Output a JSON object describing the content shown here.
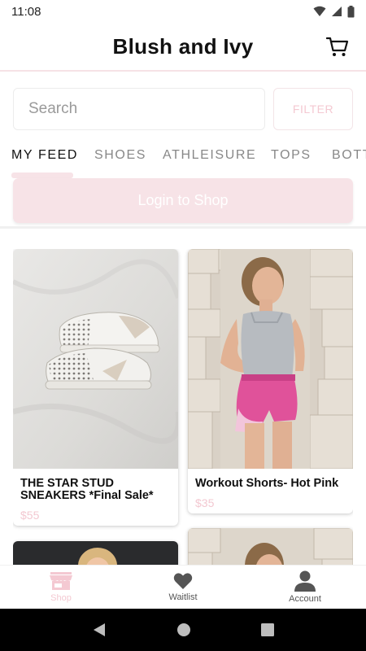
{
  "status_bar": {
    "time": "11:08"
  },
  "header": {
    "title": "Blush and Ivy"
  },
  "search": {
    "placeholder": "Search",
    "filter_label": "FILTER"
  },
  "tabs": [
    {
      "label": "MY FEED",
      "active": true
    },
    {
      "label": "SHOES",
      "active": false
    },
    {
      "label": "ATHLEISURE",
      "active": false
    },
    {
      "label": "TOPS",
      "active": false
    },
    {
      "label": "BOTT",
      "active": false
    }
  ],
  "login_banner": {
    "label": "Login to Shop"
  },
  "products": [
    {
      "title": "THE STAR STUD SNEAKERS *Final Sale*",
      "price": "$55",
      "image": "white star-stud sneakers photo"
    },
    {
      "title": "Workout Shorts- Hot Pink",
      "price": "$35",
      "image": "model in hot pink shorts photo"
    },
    {
      "title": "",
      "price": "",
      "image": "partial product photo"
    },
    {
      "title": "",
      "price": "",
      "image": "partial product photo"
    }
  ],
  "bottom_nav": {
    "items": [
      {
        "label": "Shop",
        "icon": "storefront-icon",
        "active": true
      },
      {
        "label": "Waitlist",
        "icon": "heart-icon",
        "active": false
      },
      {
        "label": "Account",
        "icon": "person-icon",
        "active": false
      }
    ]
  },
  "colors": {
    "accent_pink": "#f4c9d2",
    "banner_pink": "#f7e3e7",
    "active_nav": "#f4c9d2"
  }
}
